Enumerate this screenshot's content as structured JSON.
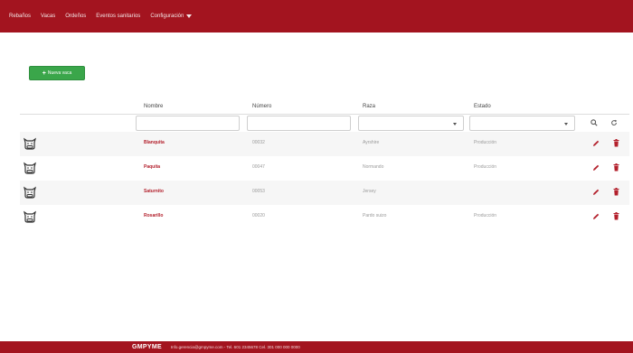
{
  "nav": {
    "items": [
      "Rebaños",
      "Vacas",
      "Ordeños",
      "Eventos sanitarios"
    ],
    "config_label": "Configuración"
  },
  "toolbar": {
    "new_cow_label": "Nueva vaca"
  },
  "table": {
    "columns": [
      "Nombre",
      "Número",
      "Raza",
      "Estado"
    ],
    "filters": {
      "nombre_placeholder": "",
      "numero_placeholder": "",
      "raza_selected": "",
      "estado_selected": ""
    },
    "rows": [
      {
        "nombre": "Blanquita",
        "numero": "00032",
        "raza": "Ayrshire",
        "estado": "Producción"
      },
      {
        "nombre": "Paquita",
        "numero": "00047",
        "raza": "Normando",
        "estado": "Producción"
      },
      {
        "nombre": "Saturnito",
        "numero": "00053",
        "raza": "Jersey",
        "estado": ""
      },
      {
        "nombre": "Rosarillo",
        "numero": "00020",
        "raza": "Pardo suizo",
        "estado": "Producción"
      }
    ]
  },
  "footer": {
    "brand": "GMPYME",
    "contact": "Info.gerencia@gmpyme.com - Tel. 601 2345678 Cel. 301 000 000 0000"
  },
  "icons": {
    "cow": "cow-icon",
    "edit": "pencil-icon",
    "delete": "trash-icon",
    "search": "search-icon",
    "reset": "refresh-icon"
  },
  "colors": {
    "brand_red": "#a3141f",
    "success_green": "#3aa64a",
    "link_red": "#b3202c"
  }
}
